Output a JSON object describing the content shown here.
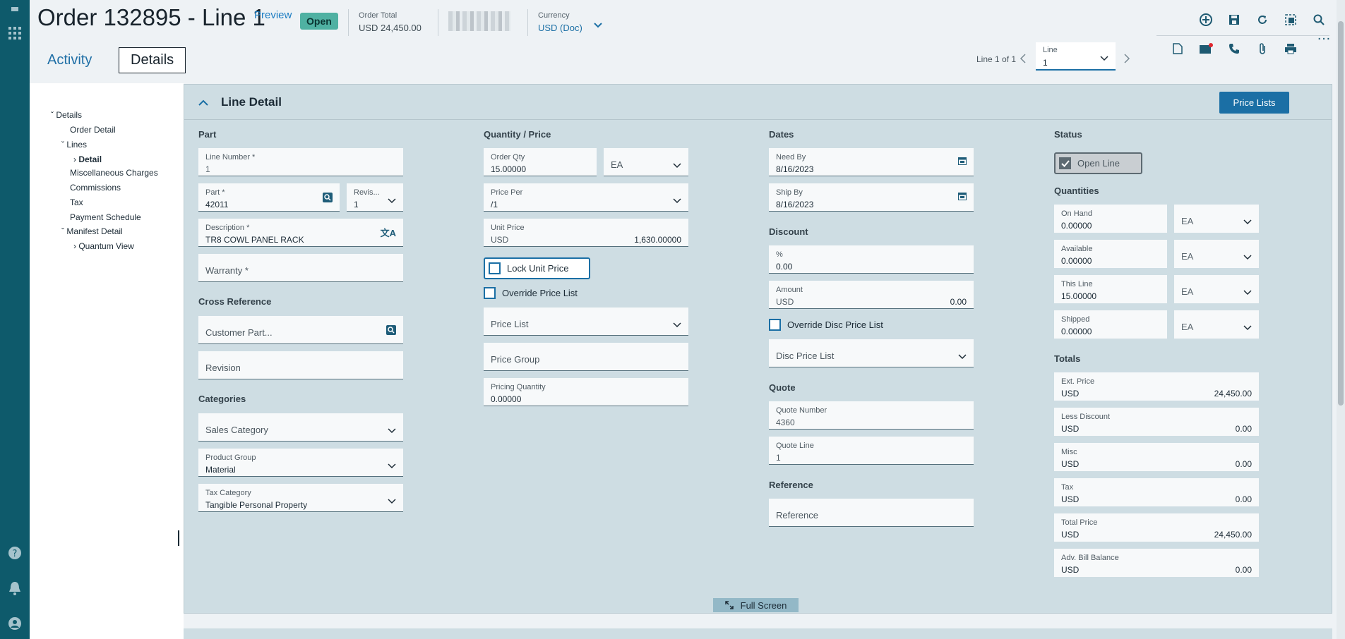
{
  "header": {
    "title": "Order 132895 - Line 1",
    "preview": "Preview",
    "status": "Open",
    "order_total_label": "Order Total",
    "order_total_value": "USD 24,450.00",
    "currency_label": "Currency",
    "currency_value": "USD (Doc)"
  },
  "tabs": {
    "activity": "Activity",
    "details": "Details"
  },
  "pager": {
    "text": "Line 1 of 1",
    "line_label": "Line",
    "line_value": "1"
  },
  "tree": {
    "details": "Details",
    "order_detail": "Order Detail",
    "lines": "Lines",
    "detail": "Detail",
    "misc_charges": "Miscellaneous Charges",
    "commissions": "Commissions",
    "tax": "Tax",
    "payment_schedule": "Payment Schedule",
    "manifest_detail": "Manifest Detail",
    "quantum_view": "Quantum View"
  },
  "panel": {
    "title": "Line Detail",
    "price_lists_button": "Price Lists",
    "full_screen": "Full Screen"
  },
  "part": {
    "group": "Part",
    "line_number_label": "Line Number *",
    "line_number": "1",
    "part_label": "Part *",
    "part": "42011",
    "revision_label": "Revis...",
    "revision": "1",
    "description_label": "Description *",
    "description": "TR8 COWL PANEL RACK",
    "warranty_placeholder": "Warranty *"
  },
  "cross_reference": {
    "group": "Cross Reference",
    "customer_part": "Customer Part...",
    "revision": "Revision"
  },
  "categories": {
    "group": "Categories",
    "sales_category": "Sales Category",
    "product_group_label": "Product Group",
    "product_group": "Material",
    "tax_category_label": "Tax Category",
    "tax_category": "Tangible Personal Property"
  },
  "qty_price": {
    "group": "Quantity / Price",
    "order_qty_label": "Order Qty",
    "order_qty": "15.00000",
    "uom": "EA",
    "price_per_label": "Price Per",
    "price_per": "/1",
    "unit_price_label": "Unit Price",
    "unit_price_currency": "USD",
    "unit_price": "1,630.00000",
    "lock_unit_price": "Lock Unit Price",
    "override_price_list": "Override Price List",
    "price_list": "Price List",
    "price_group": "Price Group",
    "pricing_quantity_label": "Pricing Quantity",
    "pricing_quantity": "0.00000"
  },
  "dates": {
    "group": "Dates",
    "need_by_label": "Need By",
    "need_by": "8/16/2023",
    "ship_by_label": "Ship By",
    "ship_by": "8/16/2023"
  },
  "discount": {
    "group": "Discount",
    "percent_label": "%",
    "percent": "0.00",
    "amount_label": "Amount",
    "amount_currency": "USD",
    "amount": "0.00",
    "override_disc": "Override Disc Price List",
    "disc_price_list": "Disc Price List"
  },
  "quote": {
    "group": "Quote",
    "quote_number_label": "Quote Number",
    "quote_number": "4360",
    "quote_line_label": "Quote Line",
    "quote_line": "1"
  },
  "reference": {
    "group": "Reference",
    "placeholder": "Reference"
  },
  "status": {
    "group": "Status",
    "open_line": "Open Line"
  },
  "quantities": {
    "group": "Quantities",
    "on_hand_label": "On Hand",
    "on_hand": "0.00000",
    "available_label": "Available",
    "available": "0.00000",
    "this_line_label": "This Line",
    "this_line": "15.00000",
    "shipped_label": "Shipped",
    "shipped": "0.00000",
    "uom": "EA"
  },
  "totals": {
    "group": "Totals",
    "currency": "USD",
    "ext_price_label": "Ext. Price",
    "ext_price": "24,450.00",
    "less_discount_label": "Less Discount",
    "less_discount": "0.00",
    "misc_label": "Misc",
    "misc": "0.00",
    "tax_label": "Tax",
    "tax": "0.00",
    "total_price_label": "Total Price",
    "total_price": "24,450.00",
    "adv_bill_label": "Adv. Bill Balance",
    "adv_bill": "0.00"
  },
  "colors": {
    "rail": "#0e5a6b",
    "accent": "#1b6fa5",
    "panel": "#cedde3",
    "status_badge": "#4fb1a2"
  }
}
